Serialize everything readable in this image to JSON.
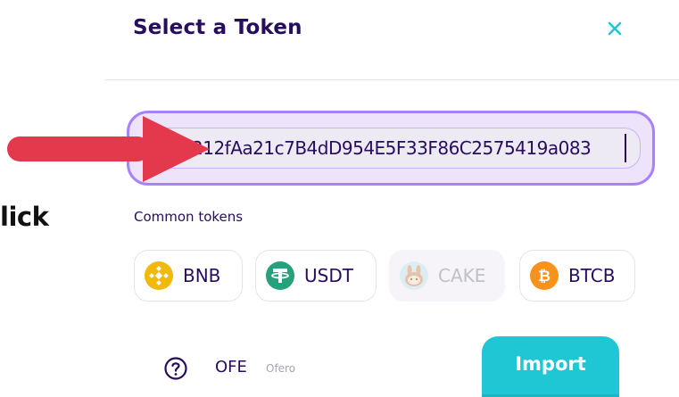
{
  "side": {
    "text": "lick"
  },
  "modal": {
    "title": "Select a Token",
    "close_icon": "close-icon",
    "search": {
      "value": "212fAa21c7B4dD954E5F33F86C2575419a083"
    },
    "common_tokens": {
      "label": "Common tokens",
      "items": [
        {
          "symbol": "BNB",
          "icon": "bnb-icon",
          "color": "#f0b90b",
          "disabled": false
        },
        {
          "symbol": "USDT",
          "icon": "usdt-icon",
          "color": "#26a17b",
          "disabled": false
        },
        {
          "symbol": "CAKE",
          "icon": "cake-icon",
          "color": "#d1884f",
          "disabled": true
        },
        {
          "symbol": "BTCB",
          "icon": "btcb-icon",
          "color": "#f7931a",
          "disabled": false
        }
      ]
    },
    "token_result": {
      "help_icon": "help-circle-icon",
      "symbol": "OFE",
      "name": "Ofero"
    },
    "import_button": {
      "label": "Import"
    }
  },
  "colors": {
    "text_primary": "#280d5f",
    "accent": "#1fc7d4",
    "focus_border": "#a881fc",
    "arrow": "#e4384c"
  }
}
